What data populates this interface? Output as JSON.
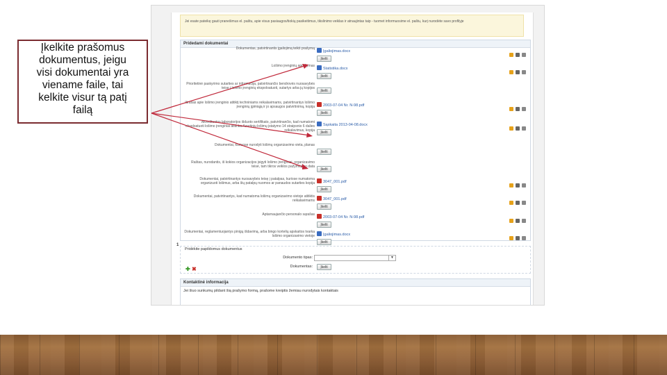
{
  "callout": {
    "lines": [
      "Įkelkite prašomus",
      "dokumentus, jeigu",
      "visi dokumentai yra",
      "viename faile, tai",
      "kelkite visur tą patį",
      "failą"
    ]
  },
  "notice": "Jei esate pateikę gauti pranešimus el. paštu, apie visus pasiaugos/tiokių pasikeitimus, tikslinimo veiklas ir atnaujintas taip - tuomet informuosime el. paštu, kurį nurodėte savo profilyje",
  "attached": {
    "title": "Pridedami dokumentai",
    "upload_label": "Įkelti",
    "rows": [
      {
        "label": "Dokumentas, patvirtinantis įgaliojimą teikti prašymą",
        "file": "Įgaliojimas.docx",
        "file_type": "word"
      },
      {
        "label": "Lošimo įrenginių aprašymas",
        "file": "Statistika.docx",
        "file_type": "word"
      },
      {
        "label": "Prioritetinė paskyrimo sutarties ar informacija, patvirtinančio bendrovės nuosavybės teisę į lošimo įrenginių ekspoloatuoti, sutartys arba jų kopijos",
        "file": "",
        "file_type": ""
      },
      {
        "label": "Išrašas apie lošimo įrenginio atitiktį techniniams reikalavimams, patvirtinantys lošimo įrenginių įgimiąją ir jo apsaugos patvirtinimą, kopija",
        "file": "2003-07-04 Nr. N-98.pdf",
        "file_type": "pdf"
      },
      {
        "label": "Akredituotos laboratorijos išduoto sertifikato, patvirtinančio, kad numatomi eksploatuoti lošimo įrenginiai atitinka Azartinių lošimų įstatymo 14 straipsnio 6 dalies reikalavimus, kopija",
        "file": "Sąskaita 2013-04-08.docx",
        "file_type": "word"
      },
      {
        "label": "Dokumentai, kuriuose nurodyti lošimų organizavimo vieta, planas",
        "file": "",
        "file_type": ""
      },
      {
        "label": "Raštas, nurodantis, iš kokios organizacijos įsigyti lošimo įrenginiai, organizavimo teisė, tam tikros veiklos pažymėjimo data",
        "file": "",
        "file_type": ""
      },
      {
        "label": "Dokumentai, patvirtinantys nuosavybės teisę į patalpas, kuriose numatoma organizuoti lošimus, arba šių patalpų nuomos ar panaudos sutarties kopija",
        "file": "3047_001.pdf",
        "file_type": "pdf"
      },
      {
        "label": "Dokumentai, patvirtinantys, kad numatoma lošimų organizavimo vietoje atitiktis reikalavimams",
        "file": "3047_001.pdf",
        "file_type": "pdf"
      },
      {
        "label": "Aptarnaujančio personalo sąrašas",
        "file": "2003-07-04 Nr. N-98.pdf",
        "file_type": "pdf"
      },
      {
        "label": "Dokumentai, reglamentuojantys pinigų išdavimą, arba bingo kortelių apskaitos tvarka lošimo organizavimo vietoje",
        "file": "Įgaliojimas.docx",
        "file_type": "word"
      }
    ]
  },
  "additional": {
    "index": "1",
    "title": "Pridėkite papildomus dokumentus",
    "type_label": "Dokumento tipas:",
    "doc_label": "Dokumentas:",
    "upload_label": "Įkelti",
    "dropdown_arrow": "▼",
    "add_icon": "plus-icon",
    "remove_icon": "cross-icon"
  },
  "contact": {
    "title": "Kontaktinė informacija",
    "text": "Jei šiuo sunkumų pildant šią prašymo formą, prašome kreiptis žemiau nurodytais kontaktais"
  },
  "colors": {
    "callout_border": "#7a2a2f",
    "arrow": "#c0283a",
    "link": "#2a5ca8",
    "floor": "#a3713f"
  }
}
